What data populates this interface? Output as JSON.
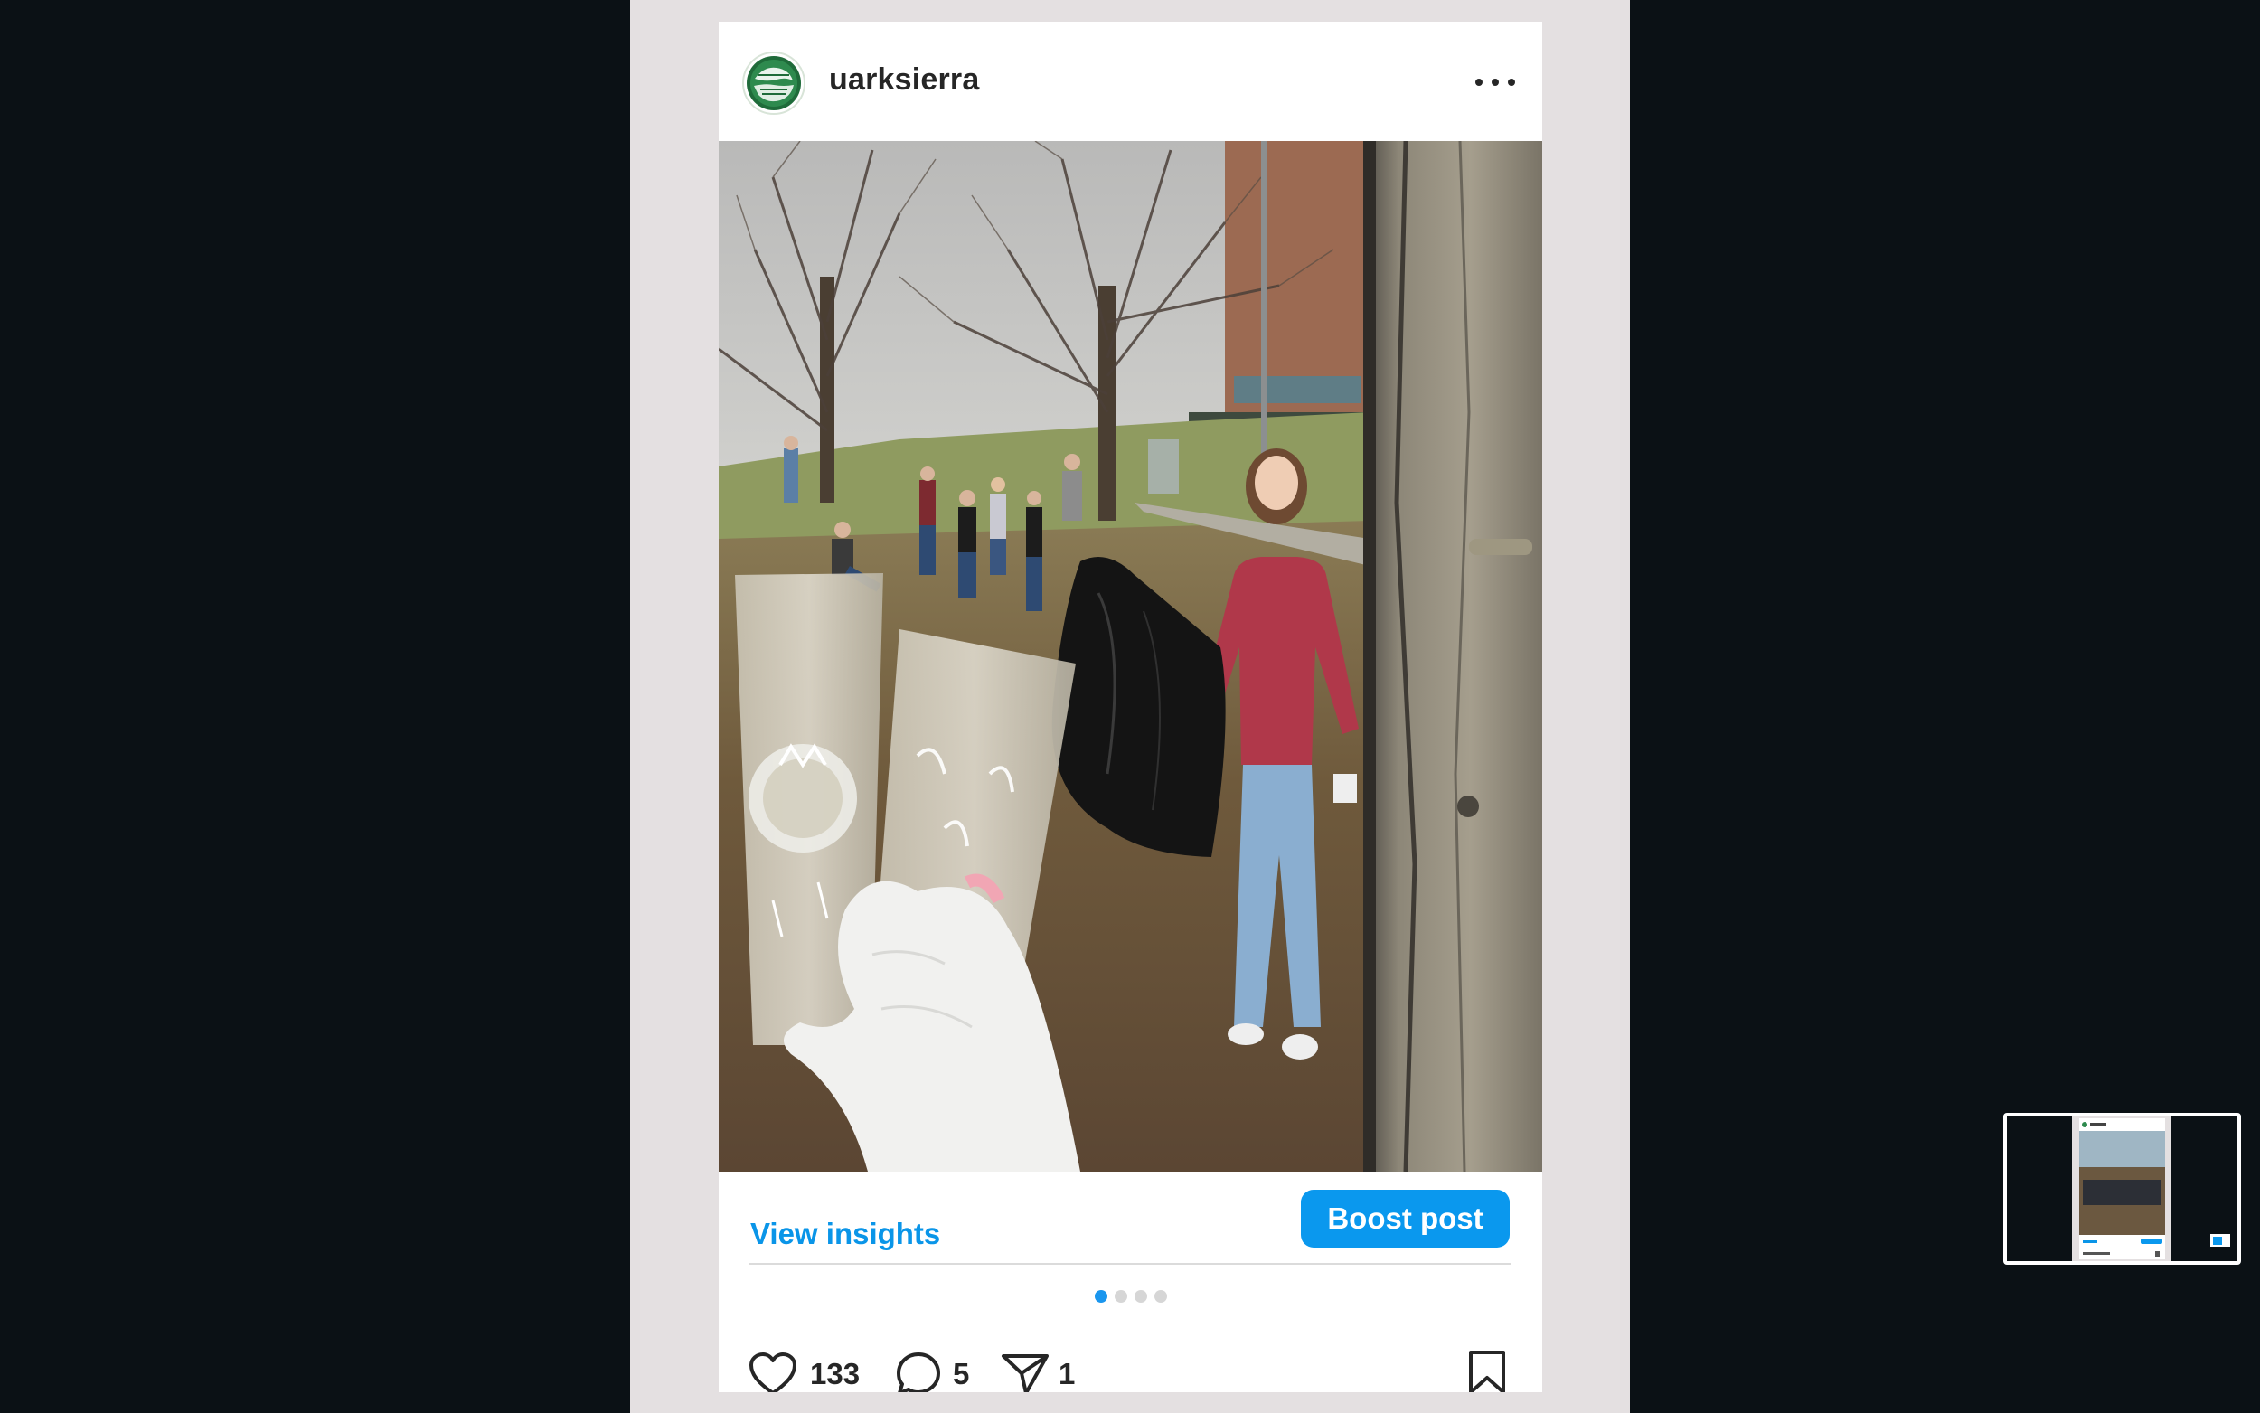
{
  "post": {
    "username": "uarksierra",
    "avatar_text": "SIERRA STUDENT COALITION",
    "more_icon": "more-horizontal-icon"
  },
  "actions": {
    "insights_label": "View insights",
    "boost_label": "Boost post"
  },
  "carousel": {
    "total": 4,
    "active": 1
  },
  "engagement": {
    "likes": "133",
    "comments": "5",
    "shares": "1"
  },
  "colors": {
    "accent": "#0a98ee",
    "link": "#0a95e8",
    "background": "#0b1115",
    "column": "#e4e0e1"
  }
}
